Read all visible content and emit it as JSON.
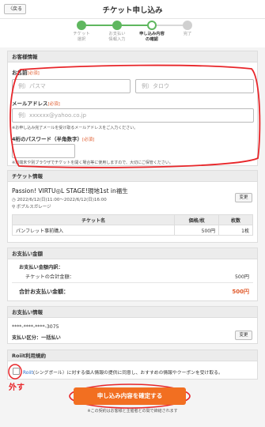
{
  "header": {
    "back_label": "〈戻る",
    "title": "チケット申し込み"
  },
  "stepper": {
    "steps": [
      {
        "label": "チケット\n選択",
        "state": "done"
      },
      {
        "label": "お支払い\n情報入力",
        "state": "done"
      },
      {
        "label": "申し込み内容\nの確認",
        "state": "current"
      },
      {
        "label": "完了",
        "state": "todo"
      }
    ],
    "accent_color": "#5fb75f"
  },
  "customer": {
    "heading": "お客様情報",
    "name_label": "お名前",
    "required_label": "[必須]",
    "last_name_placeholder": "例）パスマ",
    "first_name_placeholder": "例）タロウ",
    "email_label": "メールアドレス",
    "email_placeholder": "例）xxxxxx@yahoo.co.jp",
    "email_note": "※お申し込み完了メールを受け取るメールアドレスをご入力ください。",
    "pin_label": "4桁のパスワード（半角数字）",
    "pin_note": "※別端末や別ブラウザでチケットを開く場合等に使用しますので、大切にご保管ください。"
  },
  "ticket": {
    "heading": "チケット情報",
    "event_title": "Passion! VIRTU◎L STAGE!現地1st in福生",
    "datetime": "2022/6/12(日)11:00〜2022/6/12(日)16:00",
    "venue": "ボプルスガレージ",
    "change_label": "変更",
    "columns": [
      "チケット名",
      "価格/枚",
      "枚数"
    ],
    "rows": [
      {
        "name": "パンフレット事前購入",
        "price": "500円",
        "qty": "1枚"
      }
    ]
  },
  "payment_amount": {
    "heading": "お支払い金額",
    "breakdown_label": "お支払い金額内訳：",
    "subtotal_label": "チケットの合計金額：",
    "subtotal_value": "500円",
    "total_label": "合計お支払い金額：",
    "total_value": "500円"
  },
  "payment_info": {
    "heading": "お支払い情報",
    "card_number": "****-****-****-3075",
    "change_label": "変更",
    "installment": "支払い区分：一括払い"
  },
  "terms": {
    "heading": "Roiit利用規約",
    "link_text": "Roiit",
    "text": "(シングボール）に対する個人情報の提供に同意し、おすすめの情報やクーポンを受け取る。",
    "annotation": "外す"
  },
  "submit": {
    "label": "申し込み内容を確定する",
    "note": "※この契約はお客様と主催者との間で締結されます"
  }
}
